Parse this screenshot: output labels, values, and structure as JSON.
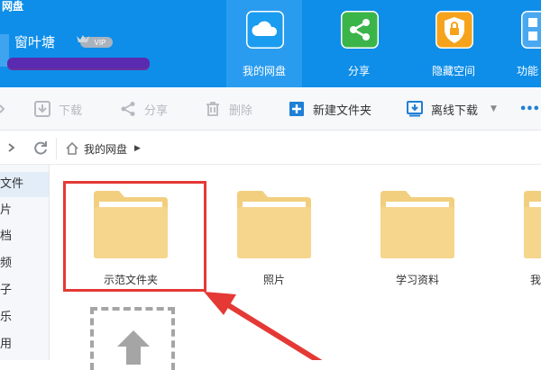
{
  "app": {
    "title": "网盘"
  },
  "user": {
    "name": "窗叶塘",
    "vip": "VIP"
  },
  "nav": [
    {
      "id": "mydisk",
      "label": "我的网盘",
      "icon": "cloud-icon",
      "color": "#1a9cf0"
    },
    {
      "id": "share",
      "label": "分享",
      "icon": "share-icon",
      "color": "#3bb54a"
    },
    {
      "id": "hidden",
      "label": "隐藏空间",
      "icon": "lock-icon",
      "color": "#f6a31b"
    },
    {
      "id": "func",
      "label": "功能",
      "icon": "grid-icon",
      "color": "#4aa8f0"
    }
  ],
  "toolbar": {
    "download": "下载",
    "share": "分享",
    "delete": "删除",
    "new_folder": "新建文件夹",
    "offline": "离线下载",
    "more": "•••"
  },
  "breadcrumb": {
    "root": "我的网盘"
  },
  "sidebar": [
    {
      "label": "文件",
      "active": true
    },
    {
      "label": "片"
    },
    {
      "label": "档"
    },
    {
      "label": "频"
    },
    {
      "label": "子"
    },
    {
      "label": "乐"
    },
    {
      "label": "用"
    }
  ],
  "files": [
    {
      "name": "示范文件夹",
      "highlighted": true
    },
    {
      "name": "照片"
    },
    {
      "name": "学习资料"
    },
    {
      "name": "我"
    }
  ],
  "colors": {
    "header": "#0e8ee9",
    "accent": "#e53935",
    "folder": "#f6d58d"
  }
}
